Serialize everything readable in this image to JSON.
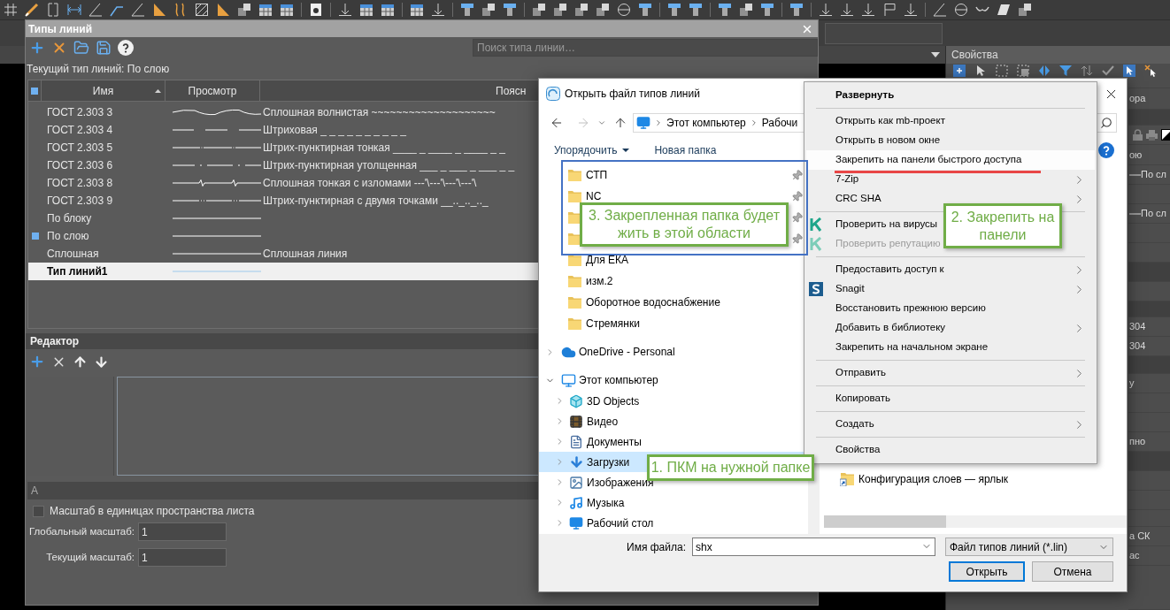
{
  "line_types_dialog": {
    "title": "Типы линий",
    "search": {
      "placeholder": "Поиск типа линии…"
    },
    "current_type": "Текущий тип линий: По слою",
    "columns": [
      {
        "label": "Имя",
        "sorted": true
      },
      {
        "label": "Просмотр",
        "sorted": false
      },
      {
        "label": "Поясн",
        "sorted": false
      }
    ],
    "rows": [
      {
        "name": "ГОСТ 2.303 3",
        "kind": "wavy",
        "description": "Сплошная волнистая ~~~~~~~~~~~~~~~~~~~~",
        "current": false,
        "selected": false
      },
      {
        "name": "ГОСТ 2.303 4",
        "kind": "dashed",
        "description": "Штриховая _ _ _ _ _ _ _ _ _ _",
        "current": false,
        "selected": false
      },
      {
        "name": "ГОСТ 2.303 5",
        "kind": "dashdot_thin",
        "description": "Штрих-пунктирная тонкая ____ _ ____ _ ____ _ _",
        "current": false,
        "selected": false
      },
      {
        "name": "ГОСТ 2.303 6",
        "kind": "dashdot_thick",
        "description": "Штрих-пунктирная утолщенная ___ _ ___ _ ___ _ _",
        "current": false,
        "selected": false
      },
      {
        "name": "ГОСТ 2.303 8",
        "kind": "zigzag",
        "description": "Сплошная тонкая с изломами ---'\\---'\\---'\\---'\\",
        "current": false,
        "selected": false
      },
      {
        "name": "ГОСТ 2.303 9",
        "kind": "dashdotdot",
        "description": "Штрих-пунктирная с двумя точками __.._.._.._",
        "current": false,
        "selected": false
      },
      {
        "name": "По блоку",
        "kind": "solid",
        "current": false,
        "selected": false
      },
      {
        "name": "По слою",
        "kind": "solid",
        "current": true,
        "selected": false
      },
      {
        "name": "Сплошная",
        "kind": "solid",
        "description": "Сплошная линия",
        "current": false,
        "selected": false
      },
      {
        "name": "Тип линий1",
        "kind": "solid",
        "current": false,
        "selected": true
      }
    ],
    "editor": {
      "title": "Редактор",
      "section": "A",
      "scale_checkbox": {
        "label": "Масштаб в единицах пространства листа",
        "checked": false
      },
      "fields": [
        {
          "label": "Глобальный масштаб:",
          "value": "1"
        },
        {
          "label": "Текущий масштаб:",
          "value": "1"
        }
      ]
    }
  },
  "properties_panel": {
    "title": "Свойства",
    "fragments": [
      {
        "text": "ора",
        "kind": "text"
      },
      {
        "text": "ою",
        "kind": "text"
      },
      {
        "text": "По сл",
        "kind": "line"
      },
      {
        "text": "По сл",
        "kind": "line"
      },
      {
        "text": "304",
        "kind": "text"
      },
      {
        "text": "304",
        "kind": "text"
      },
      {
        "text": "у",
        "kind": "text"
      },
      {
        "text": "пно",
        "kind": "text"
      },
      {
        "text": "а СК",
        "kind": "text"
      },
      {
        "text": "ас",
        "kind": "text"
      }
    ]
  },
  "file_dialog": {
    "title": "Открыть файл типов линий",
    "address": [
      "Этот компьютер",
      "Рабочи"
    ],
    "commands": [
      {
        "label": "Упорядочить",
        "dropdown": true
      },
      {
        "label": "Новая папка",
        "dropdown": false
      }
    ],
    "quick_access": [
      {
        "label": "СТП",
        "pinned": true,
        "selected": false
      },
      {
        "label": "NC",
        "pinned": true,
        "selected": false
      },
      {
        "pinned": true,
        "selected": false
      },
      {
        "pinned": true,
        "selected": false
      },
      {
        "label": "Для ЕКА",
        "pinned": false,
        "selected": false
      },
      {
        "label": "изм.2",
        "pinned": false,
        "selected": false
      },
      {
        "label": "Оборотное водоснабжение",
        "pinned": false,
        "selected": false
      },
      {
        "label": "Стремянки",
        "pinned": false,
        "selected": false
      }
    ],
    "locations": [
      {
        "label": "OneDrive - Personal",
        "expanded": false,
        "selected": false
      },
      {
        "label": "Этот компьютер",
        "expanded": true,
        "selected": false,
        "children": [
          {
            "label": "3D Objects",
            "expanded": false,
            "selected": false
          },
          {
            "label": "Видео",
            "expanded": false,
            "selected": false
          },
          {
            "label": "Документы",
            "expanded": false,
            "selected": false
          },
          {
            "label": "Загрузки",
            "expanded": false,
            "selected": true
          },
          {
            "label": "Изображения",
            "expanded": false,
            "selected": false
          },
          {
            "label": "Музыка",
            "expanded": false,
            "selected": false
          },
          {
            "label": "Рабочий стол",
            "expanded": false,
            "selected": false
          }
        ]
      }
    ],
    "files": [
      {
        "label": "Конфигурация слоев — ярлык"
      }
    ],
    "file_name": {
      "label": "Имя файла:",
      "value": "shx"
    },
    "file_type": {
      "value": "Файл типов линий (*.lin)"
    },
    "buttons": [
      {
        "label": "Открыть",
        "default": true
      },
      {
        "label": "Отмена",
        "default": false
      }
    ]
  },
  "context_menu": {
    "items": [
      {
        "kind": "item",
        "label": "Развернуть",
        "bold": true,
        "submenu": false,
        "disabled": false,
        "highlighted": false
      },
      {
        "kind": "separator"
      },
      {
        "kind": "item",
        "label": "Открыть как mb-проект",
        "bold": false,
        "submenu": false,
        "disabled": false,
        "highlighted": false
      },
      {
        "kind": "item",
        "label": "Открыть в новом окне",
        "bold": false,
        "submenu": false,
        "disabled": false,
        "highlighted": false
      },
      {
        "kind": "item",
        "label": "Закрепить на панели быстрого доступа",
        "bold": false,
        "submenu": false,
        "disabled": false,
        "highlighted": true
      },
      {
        "kind": "item",
        "label": "7-Zip",
        "bold": false,
        "submenu": true,
        "disabled": false,
        "highlighted": false
      },
      {
        "kind": "item",
        "label": "CRC SHA",
        "bold": false,
        "submenu": true,
        "disabled": false,
        "highlighted": false
      },
      {
        "kind": "separator"
      },
      {
        "kind": "item",
        "label": "Проверить на вирусы",
        "bold": false,
        "submenu": false,
        "disabled": false,
        "highlighted": false
      },
      {
        "kind": "item",
        "label": "Проверить репутацию",
        "bold": false,
        "submenu": false,
        "disabled": true,
        "highlighted": false
      },
      {
        "kind": "separator"
      },
      {
        "kind": "item",
        "label": "Предоставить доступ к",
        "bold": false,
        "submenu": true,
        "disabled": false,
        "highlighted": false
      },
      {
        "kind": "item",
        "label": "Snagit",
        "bold": false,
        "submenu": true,
        "disabled": false,
        "highlighted": false
      },
      {
        "kind": "item",
        "label": "Восстановить прежнюю версию",
        "bold": false,
        "submenu": false,
        "disabled": false,
        "highlighted": false
      },
      {
        "kind": "item",
        "label": "Добавить в библиотеку",
        "bold": false,
        "submenu": true,
        "disabled": false,
        "highlighted": false
      },
      {
        "kind": "item",
        "label": "Закрепить на начальном экране",
        "bold": false,
        "submenu": false,
        "disabled": false,
        "highlighted": false
      },
      {
        "kind": "separator"
      },
      {
        "kind": "item",
        "label": "Отправить",
        "bold": false,
        "submenu": true,
        "disabled": false,
        "highlighted": false
      },
      {
        "kind": "separator"
      },
      {
        "kind": "item",
        "label": "Копировать",
        "bold": false,
        "submenu": false,
        "disabled": false,
        "highlighted": false
      },
      {
        "kind": "separator"
      },
      {
        "kind": "item",
        "label": "Создать",
        "bold": false,
        "submenu": true,
        "disabled": false,
        "highlighted": false
      },
      {
        "kind": "separator"
      },
      {
        "kind": "item",
        "label": "Свойства",
        "bold": false,
        "submenu": false,
        "disabled": false,
        "highlighted": false
      }
    ]
  },
  "annotations": [
    {
      "text": "3. Закрепленная папка будет жить в этой области"
    },
    {
      "text": "2. Закрепить на панели"
    },
    {
      "text": "1. ПКМ на нужной папке"
    }
  ]
}
